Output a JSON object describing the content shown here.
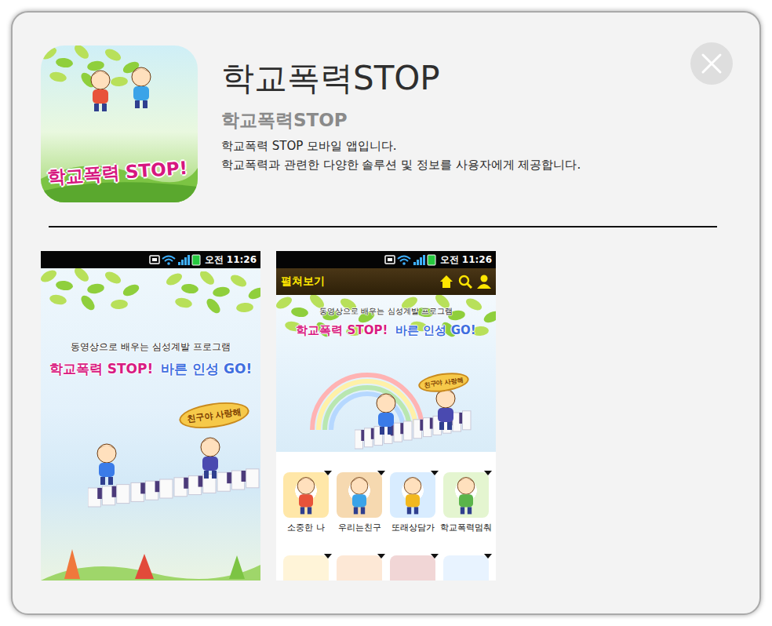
{
  "app": {
    "title": "학교폭력STOP",
    "subtitle": "학교폭력STOP",
    "description": [
      "학교폭력 STOP 모바일 앱입니다.",
      "학교폭력과 관련한 다양한 솔루션 및 정보를 사용자에게 제공합니다."
    ],
    "icon_caption": "학교폭력 STOP!"
  },
  "screenshots": [
    {
      "kind": "splash",
      "status_time": "오전 11:26",
      "banner": {
        "headline": "동영상으로 배우는 심성계발 프로그램",
        "slogan": [
          "학교폭력 STOP!",
          "바른 인성 GO!"
        ],
        "sign": "친구야 사랑해"
      }
    },
    {
      "kind": "menu",
      "status_time": "오전 11:26",
      "header": "펼쳐보기",
      "banner": {
        "headline": "동영상으로 배우는 심성계발 프로그램",
        "slogan": [
          "학교폭력 STOP!",
          "바른 인성 GO!"
        ],
        "sign": "친구야 사랑해"
      },
      "menu_items": [
        {
          "label": "소중한 나"
        },
        {
          "label": "우리는친구"
        },
        {
          "label": "또래상담가"
        },
        {
          "label": "학교폭력멈춰"
        }
      ]
    }
  ]
}
